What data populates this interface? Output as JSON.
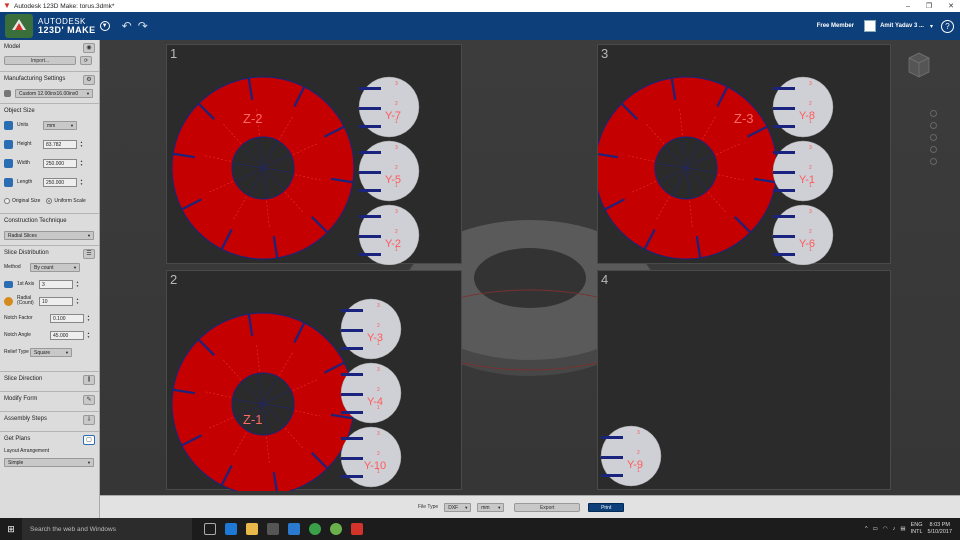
{
  "window": {
    "title": "Autodesk 123D Make: torus.3dmk*",
    "controls": [
      "–",
      "❐",
      "✕"
    ]
  },
  "header": {
    "brand_line1": "AUTODESK",
    "brand_line2": "123D' MAKE",
    "membership": "Free Member",
    "user_name": "Amit Yadav 3 ...",
    "help": "?"
  },
  "panel": {
    "model": {
      "title": "Model",
      "import_label": "Import..."
    },
    "manufacturing": {
      "title": "Manufacturing Settings",
      "material": "Custom 12.00inx16.00inx0"
    },
    "object_size": {
      "title": "Object Size",
      "units_label": "Units",
      "units_value": "mm",
      "height_label": "Height",
      "height_value": "83.782",
      "width_label": "Width",
      "width_value": "250.000",
      "length_label": "Length",
      "length_value": "250.000",
      "original_size": "Original Size",
      "uniform_scale": "Uniform Scale"
    },
    "construction": {
      "title": "Construction Technique",
      "value": "Radial Slices"
    },
    "slice_distribution": {
      "title": "Slice Distribution",
      "method_label": "Method",
      "method_value": "By count",
      "axis1_label": "1st Axis",
      "axis1_value": "3",
      "radial_label": "Radial (Count)",
      "radial_value": "10",
      "notch_factor_label": "Notch Factor",
      "notch_factor_value": "0.100",
      "notch_angle_label": "Notch Angle",
      "notch_angle_value": "45.000",
      "relief_label": "Relief Type",
      "relief_value": "Square"
    },
    "slice_direction": {
      "title": "Slice Direction"
    },
    "modify_form": {
      "title": "Modify Form"
    },
    "assembly_steps": {
      "title": "Assembly Steps"
    },
    "get_plans": {
      "title": "Get Plans",
      "layout_label": "Layout Arrangement",
      "layout_value": "Simple"
    }
  },
  "sheets": [
    {
      "number": "1",
      "ring_labels": [
        "Z-2"
      ],
      "slices": [
        "Y-7",
        "Y-5",
        "Y-2"
      ]
    },
    {
      "number": "2",
      "ring_labels": [
        "Z-1"
      ],
      "slices": [
        "Y-3",
        "Y-4",
        "Y-10"
      ]
    },
    {
      "number": "3",
      "ring_labels": [
        "Z-3"
      ],
      "slices": [
        "Y-8",
        "Y-1",
        "Y-6"
      ]
    },
    {
      "number": "4",
      "ring_labels": [],
      "slices": [
        "Y-9"
      ]
    }
  ],
  "slice_notch_numbers": [
    "3",
    "2",
    "1"
  ],
  "bottom": {
    "file_type_label": "File Type",
    "file_type_value": "DXF",
    "units_value": "mm",
    "export_label": "Export",
    "print_label": "Print"
  },
  "taskbar": {
    "search_placeholder": "Search the web and Windows",
    "time": "8:03 PM",
    "date": "5/10/2017",
    "lang_line1": "ENG",
    "lang_line2": "INTL"
  },
  "colors": {
    "header_blue": "#0d3f7a",
    "ring_red": "#c40000",
    "slot_navy": "#1a237e",
    "slice_gray": "#cfcfd6"
  }
}
